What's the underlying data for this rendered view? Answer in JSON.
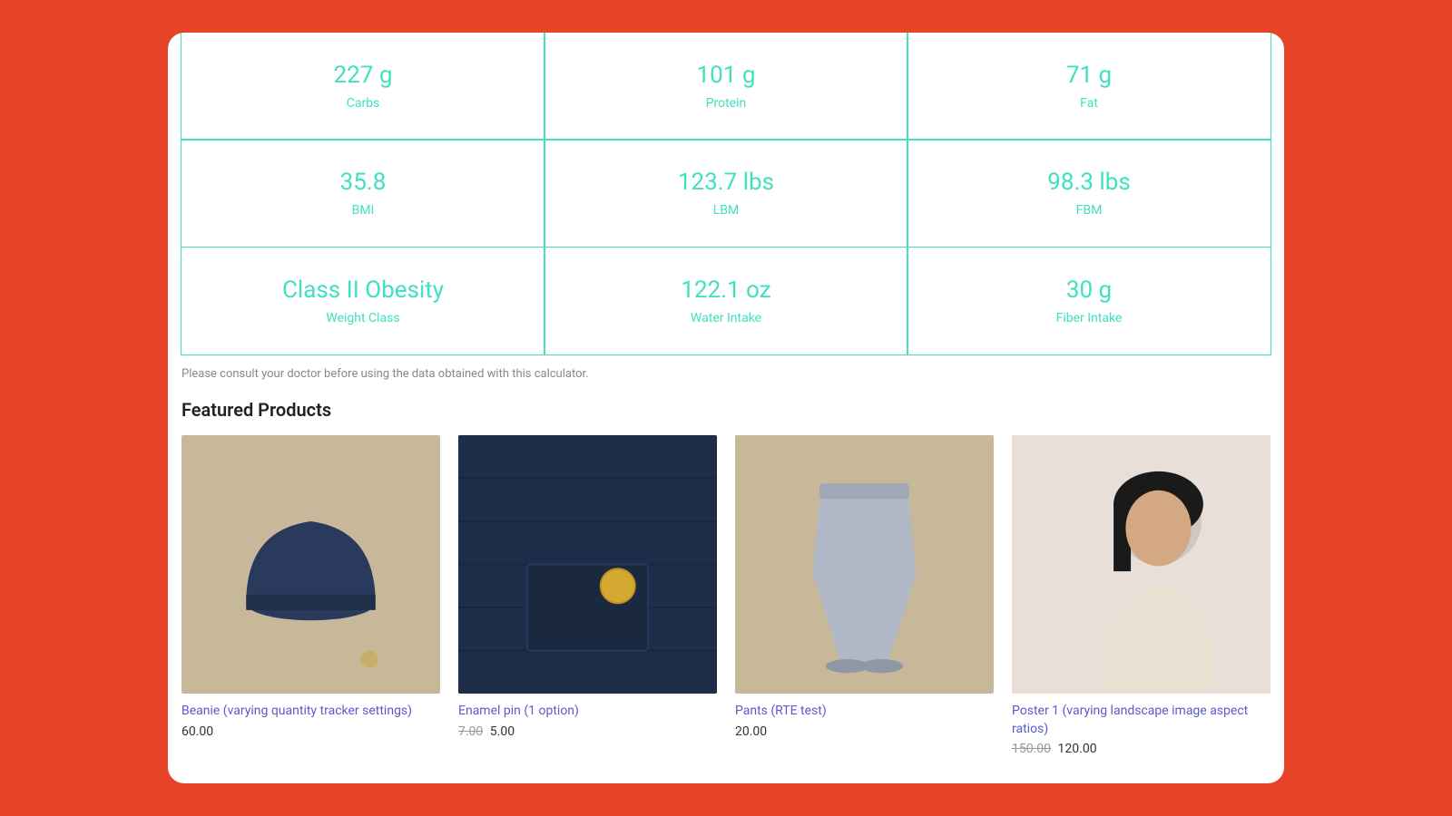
{
  "metrics": {
    "row1": [
      {
        "value": "227 g",
        "label": "Carbs"
      },
      {
        "value": "101 g",
        "label": "Protein"
      },
      {
        "value": "71 g",
        "label": "Fat"
      }
    ],
    "row2": [
      {
        "value": "35.8",
        "label": "BMI"
      },
      {
        "value": "123.7 lbs",
        "label": "LBM"
      },
      {
        "value": "98.3 lbs",
        "label": "FBM"
      }
    ],
    "row3": [
      {
        "value": "Class II Obesity",
        "label": "Weight Class"
      },
      {
        "value": "122.1 oz",
        "label": "Water Intake"
      },
      {
        "value": "30 g",
        "label": "Fiber Intake"
      }
    ]
  },
  "disclaimer": "Please consult your doctor before using the data obtained with this calculator.",
  "featured": {
    "title": "Featured Products",
    "products": [
      {
        "name": "Beanie (varying quantity tracker settings)",
        "price_regular": "",
        "price_sale": "60.00",
        "has_sale": false,
        "img_type": "beanie"
      },
      {
        "name": "Enamel pin (1 option)",
        "price_regular": "7.00",
        "price_sale": "5.00",
        "has_sale": true,
        "img_type": "enamel"
      },
      {
        "name": "Pants (RTE test)",
        "price_regular": "",
        "price_sale": "20.00",
        "has_sale": false,
        "img_type": "pants"
      },
      {
        "name": "Poster 1 (varying landscape image aspect ratios)",
        "price_regular": "150.00",
        "price_sale": "120.00",
        "has_sale": true,
        "img_type": "poster"
      }
    ]
  }
}
